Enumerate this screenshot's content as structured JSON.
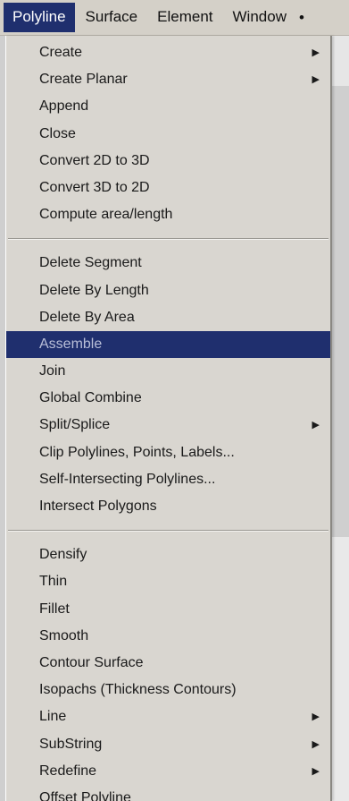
{
  "menubar": {
    "items": [
      {
        "label": "Polyline",
        "active": true
      },
      {
        "label": "Surface",
        "active": false
      },
      {
        "label": "Element",
        "active": false
      },
      {
        "label": "Window",
        "active": false
      }
    ]
  },
  "menu": {
    "groups": [
      [
        {
          "label": "Create",
          "submenu": true
        },
        {
          "label": "Create Planar",
          "submenu": true
        },
        {
          "label": "Append",
          "submenu": false
        },
        {
          "label": "Close",
          "submenu": false
        },
        {
          "label": "Convert 2D to 3D",
          "submenu": false
        },
        {
          "label": "Convert 3D to 2D",
          "submenu": false
        },
        {
          "label": "Compute area/length",
          "submenu": false
        }
      ],
      [
        {
          "label": "Delete Segment",
          "submenu": false
        },
        {
          "label": "Delete By Length",
          "submenu": false
        },
        {
          "label": "Delete By Area",
          "submenu": false
        },
        {
          "label": "Assemble",
          "submenu": false,
          "highlighted": true
        },
        {
          "label": "Join",
          "submenu": false
        },
        {
          "label": "Global Combine",
          "submenu": false
        },
        {
          "label": "Split/Splice",
          "submenu": true
        },
        {
          "label": "Clip Polylines, Points, Labels...",
          "submenu": false
        },
        {
          "label": "Self-Intersecting Polylines...",
          "submenu": false
        },
        {
          "label": "Intersect Polygons",
          "submenu": false
        }
      ],
      [
        {
          "label": "Densify",
          "submenu": false
        },
        {
          "label": "Thin",
          "submenu": false
        },
        {
          "label": "Fillet",
          "submenu": false
        },
        {
          "label": "Smooth",
          "submenu": false
        },
        {
          "label": "Contour Surface",
          "submenu": false
        },
        {
          "label": "Isopachs (Thickness Contours)",
          "submenu": false
        },
        {
          "label": "Line",
          "submenu": true
        },
        {
          "label": "SubString",
          "submenu": true
        },
        {
          "label": "Redefine",
          "submenu": true
        },
        {
          "label": "Offset Polyline",
          "submenu": false
        }
      ]
    ],
    "submenu_arrow_icon": "triangle-right-icon",
    "colors": {
      "highlight_bg": "#1f2f6e",
      "menu_bg": "#d9d6d0",
      "menubar_bg": "#d4d0c8"
    }
  }
}
